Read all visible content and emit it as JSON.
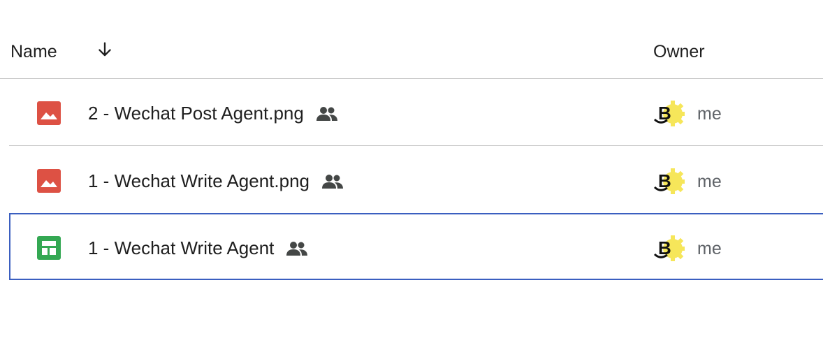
{
  "header": {
    "name_label": "Name",
    "sort_icon": "arrow-down-icon",
    "owner_label": "Owner"
  },
  "files": [
    {
      "name": "2 - Wechat Post Agent.png",
      "type": "image",
      "type_icon": "image-file-icon",
      "shared_icon": "people-icon",
      "owner": "me"
    },
    {
      "name": "1 - Wechat Write Agent.png",
      "type": "image",
      "type_icon": "image-file-icon",
      "shared_icon": "people-icon",
      "owner": "me"
    },
    {
      "name": "1 - Wechat Write Agent",
      "type": "spreadsheet",
      "type_icon": "sheets-file-icon",
      "shared_icon": "people-icon",
      "owner": "me"
    }
  ],
  "colors": {
    "image_icon": "#dd5144",
    "sheets_icon": "#34a853",
    "selection_border": "#3b5fc0",
    "avatar_gear": "#f6e65a"
  }
}
